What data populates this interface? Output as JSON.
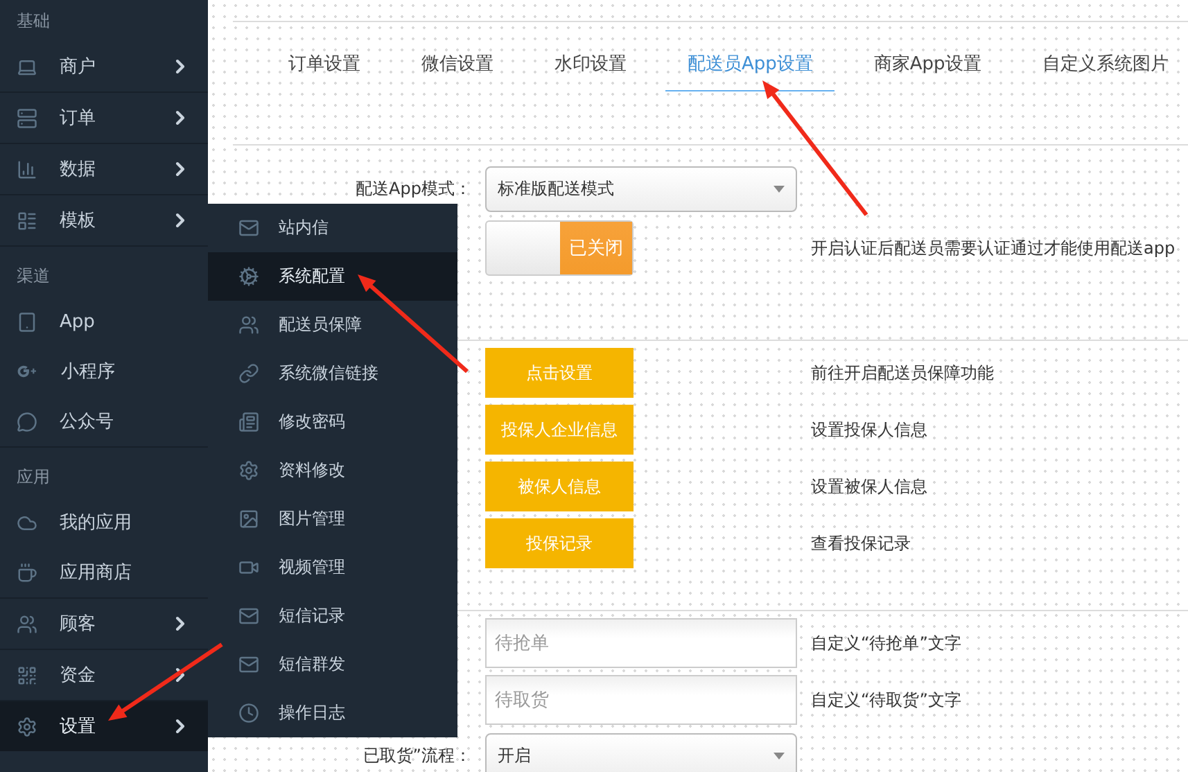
{
  "sidebar": {
    "items": [
      {
        "kind": "header",
        "label": "基础"
      },
      {
        "kind": "item",
        "label": "商户",
        "has_submenu": true,
        "selected": false
      },
      {
        "kind": "item",
        "label": "订单",
        "has_submenu": true,
        "selected": false
      },
      {
        "kind": "item",
        "label": "数据",
        "has_submenu": true,
        "selected": false
      },
      {
        "kind": "item",
        "label": "模板",
        "has_submenu": true,
        "selected": false
      },
      {
        "kind": "header",
        "label": "渠道"
      },
      {
        "kind": "item",
        "label": "App",
        "has_submenu": false,
        "selected": false
      },
      {
        "kind": "item",
        "label": "小程序",
        "has_submenu": false,
        "selected": false
      },
      {
        "kind": "item",
        "label": "公众号",
        "has_submenu": false,
        "selected": false
      },
      {
        "kind": "header",
        "label": "应用"
      },
      {
        "kind": "item",
        "label": "我的应用",
        "has_submenu": false,
        "selected": false
      },
      {
        "kind": "item",
        "label": "应用商店",
        "has_submenu": false,
        "selected": false
      },
      {
        "kind": "item",
        "label": "顾客",
        "has_submenu": true,
        "selected": false
      },
      {
        "kind": "item",
        "label": "资金",
        "has_submenu": true,
        "selected": false
      },
      {
        "kind": "item",
        "label": "设置",
        "has_submenu": true,
        "selected": true
      }
    ]
  },
  "submenu": {
    "items": [
      {
        "label": "站内信",
        "selected": false
      },
      {
        "label": "系统配置",
        "selected": true
      },
      {
        "label": "配送员保障",
        "selected": false
      },
      {
        "label": "系统微信链接",
        "selected": false
      },
      {
        "label": "修改密码",
        "selected": false
      },
      {
        "label": "资料修改",
        "selected": false
      },
      {
        "label": "图片管理",
        "selected": false
      },
      {
        "label": "视频管理",
        "selected": false
      },
      {
        "label": "短信记录",
        "selected": false
      },
      {
        "label": "短信群发",
        "selected": false
      },
      {
        "label": "操作日志",
        "selected": false
      }
    ]
  },
  "tabs": [
    {
      "label": "订单设置",
      "selected": false
    },
    {
      "label": "微信设置",
      "selected": false
    },
    {
      "label": "水印设置",
      "selected": false
    },
    {
      "label": "配送员App设置",
      "selected": true
    },
    {
      "label": "商家App设置",
      "selected": false
    },
    {
      "label": "自定义系统图片",
      "selected": false
    }
  ],
  "form": {
    "sections": [
      {
        "rows": [
          {
            "kind": "select",
            "label": "配送App模式：",
            "value": "标准版配送模式"
          },
          {
            "kind": "toggle",
            "on": false,
            "state_text": "已关闭",
            "hint": "开启认证后配送员需要认证通过才能使用配送app"
          }
        ]
      },
      {
        "rows": [
          {
            "kind": "button",
            "button": "点击设置",
            "hint": "前往开启配送员保障功能"
          },
          {
            "kind": "button",
            "button": "投保人企业信息",
            "hint": "设置投保人信息"
          },
          {
            "kind": "button",
            "button": "被保人信息",
            "hint": "设置被保人信息"
          },
          {
            "kind": "button",
            "button": "投保记录",
            "hint": "查看投保记录"
          }
        ]
      },
      {
        "rows": [
          {
            "kind": "input",
            "placeholder": "待抢单",
            "hint": "自定义“待抢单”文字"
          },
          {
            "kind": "input",
            "placeholder": "待取货",
            "hint": "自定义“待取货”文字"
          },
          {
            "kind": "select",
            "label": "已取货”流程：",
            "value": "开启"
          }
        ]
      }
    ]
  }
}
